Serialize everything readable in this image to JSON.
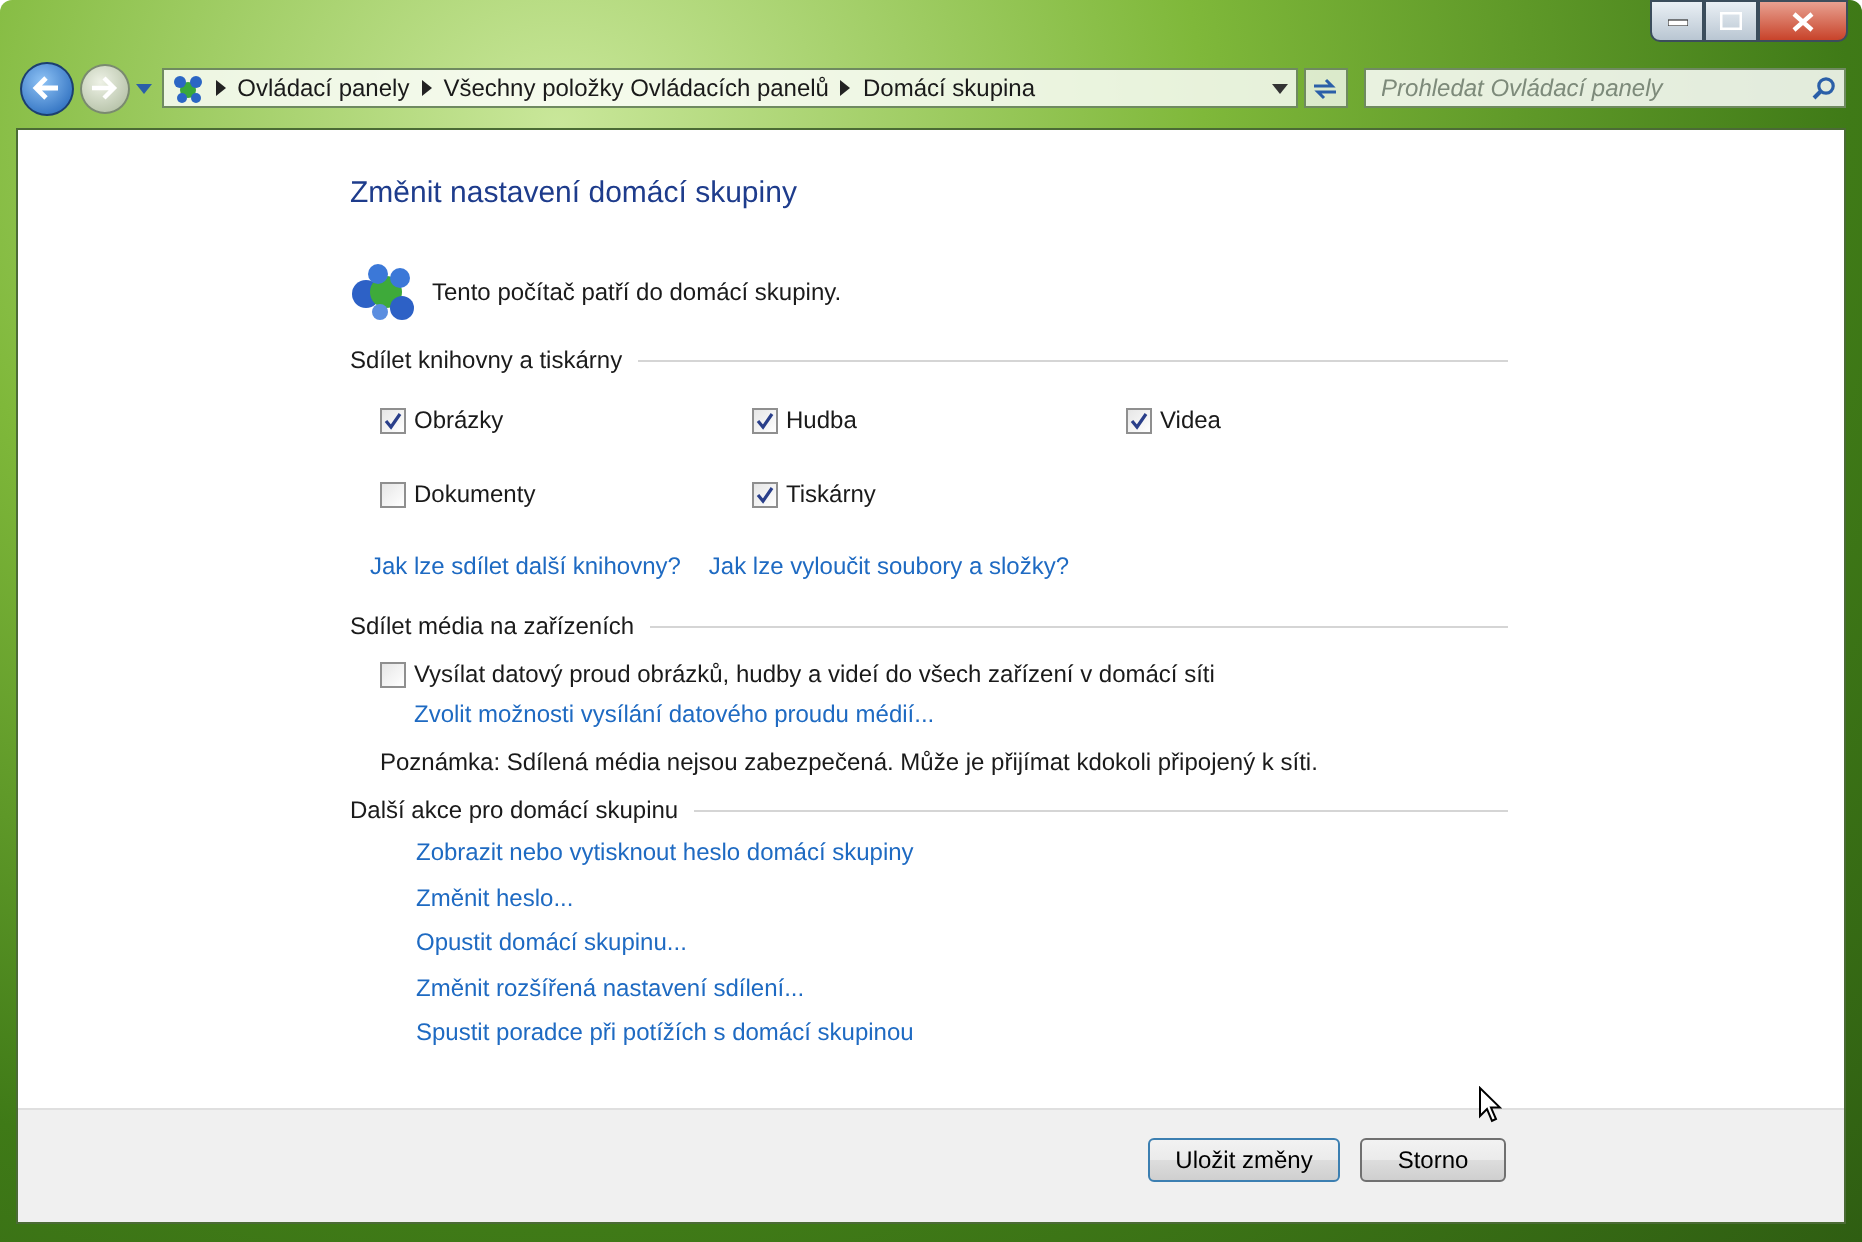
{
  "address_bar": {
    "breadcrumbs": [
      "Ovládací panely",
      "Všechny položky Ovládacích panelů",
      "Domácí skupina"
    ]
  },
  "search": {
    "placeholder": "Prohledat Ovládací panely"
  },
  "title": "Změnit nastavení domácí skupiny",
  "status": "Tento počítač patří do domácí skupiny.",
  "libraries": {
    "heading": "Sdílet knihovny a tiskárny",
    "items": [
      {
        "label": "Obrázky",
        "checked": true
      },
      {
        "label": "Hudba",
        "checked": true
      },
      {
        "label": "Videa",
        "checked": true
      },
      {
        "label": "Dokumenty",
        "checked": false
      },
      {
        "label": "Tiskárny",
        "checked": true
      }
    ],
    "links": [
      "Jak lze sdílet další knihovny?",
      "Jak lze vyloučit soubory a složky?"
    ]
  },
  "media": {
    "heading": "Sdílet média na zařízeních",
    "checkbox": {
      "label": "Vysílat datový proud obrázků, hudby a videí do všech zařízení v domácí síti",
      "checked": false
    },
    "link": "Zvolit možnosti vysílání datového proudu médií...",
    "note": "Poznámka: Sdílená média nejsou zabezpečená. Může je přijímat kdokoli připojený k síti."
  },
  "actions": {
    "heading": "Další akce pro domácí skupinu",
    "links": [
      "Zobrazit nebo vytisknout heslo domácí skupiny",
      "Změnit heslo...",
      "Opustit domácí skupinu...",
      "Změnit rozšířená nastavení sdílení...",
      "Spustit poradce při potížích s domácí skupinou"
    ]
  },
  "buttons": [
    "Uložit změny",
    "Storno"
  ]
}
